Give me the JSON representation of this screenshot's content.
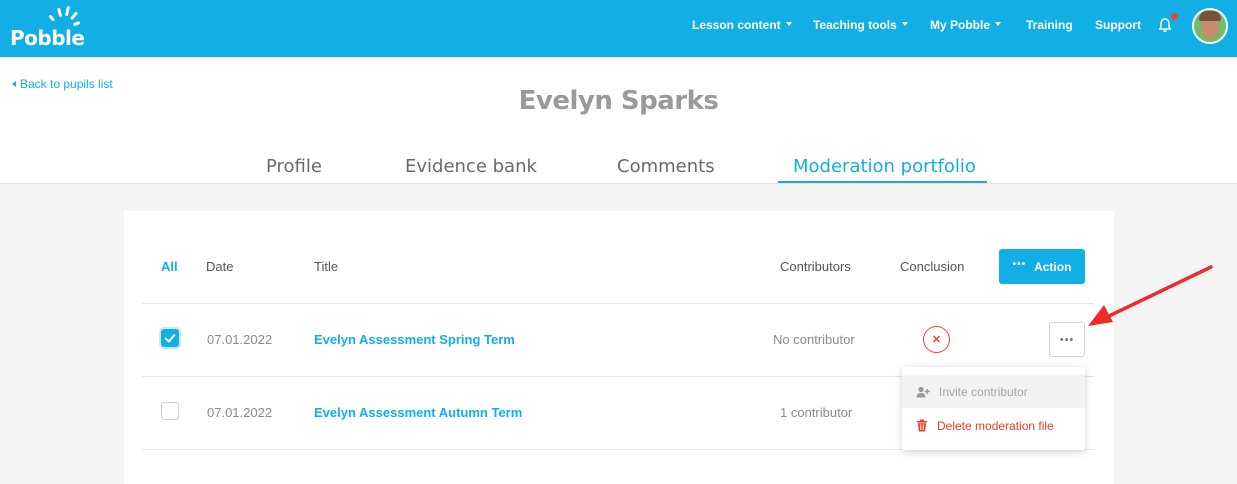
{
  "header": {
    "logo_text": "Pobble",
    "nav": [
      {
        "label": "Lesson content",
        "has_dropdown": true
      },
      {
        "label": "Teaching tools",
        "has_dropdown": true
      },
      {
        "label": "My Pobble",
        "has_dropdown": true
      },
      {
        "label": "Training",
        "has_dropdown": false
      },
      {
        "label": "Support",
        "has_dropdown": false
      }
    ],
    "notification_icon": "bell-icon",
    "has_unread_notification": true
  },
  "page": {
    "back_link": "Back to pupils list",
    "pupil_name": "Evelyn Sparks",
    "tabs": [
      {
        "label": "Profile",
        "active": false
      },
      {
        "label": "Evidence bank",
        "active": false
      },
      {
        "label": "Comments",
        "active": false
      },
      {
        "label": "Moderation portfolio",
        "active": true
      }
    ]
  },
  "table": {
    "columns": {
      "all": "All",
      "date": "Date",
      "title": "Title",
      "contributors": "Contributors",
      "conclusion": "Conclusion"
    },
    "action_button": "Action",
    "rows": [
      {
        "checked": true,
        "date": "07.01.2022",
        "title": "Evelyn Assessment Spring Term",
        "contributors": "No contributor",
        "conclusion": "negative"
      },
      {
        "checked": false,
        "date": "07.01.2022",
        "title": "Evelyn Assessment Autumn Term",
        "contributors": "1 contributor",
        "conclusion": ""
      }
    ]
  },
  "row_menu": {
    "items": [
      {
        "label": "Invite contributor",
        "icon": "add-user-icon",
        "disabled": true
      },
      {
        "label": "Delete moderation file",
        "icon": "trash-icon",
        "disabled": false
      }
    ]
  },
  "colors": {
    "brand": "#12aee6",
    "danger": "#e0402f",
    "annotation_arrow": "#ee2b2b"
  }
}
